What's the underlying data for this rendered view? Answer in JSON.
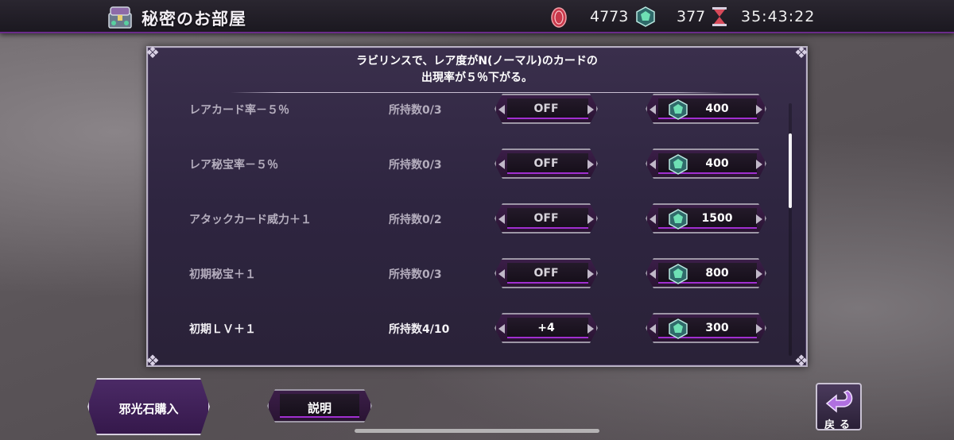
{
  "header": {
    "title": "秘密のお部屋",
    "coins": "4773",
    "gems": "377",
    "timer": "35:43:22"
  },
  "panel": {
    "description_line1": "ラビリンスで、レア度がN(ノーマル)のカードの",
    "description_line2": "出現率が５％下がる。",
    "rows": [
      {
        "name": "レアカード率－５％",
        "owned": "所持数0/3",
        "toggle": "OFF",
        "price": "400"
      },
      {
        "name": "レア秘宝率－５％",
        "owned": "所持数0/3",
        "toggle": "OFF",
        "price": "400"
      },
      {
        "name": "アタックカード威力＋１",
        "owned": "所持数0/2",
        "toggle": "OFF",
        "price": "1500"
      },
      {
        "name": "初期秘宝＋１",
        "owned": "所持数0/3",
        "toggle": "OFF",
        "price": "800"
      },
      {
        "name": "初期ＬＶ＋１",
        "owned": "所持数4/10",
        "toggle": "+4",
        "price": "300"
      }
    ]
  },
  "footer": {
    "buy_label": "邪光石購入",
    "explain_label": "説明",
    "back_label": "戻る"
  },
  "icons": {
    "room": "treasure-chest-icon",
    "coin": "coin-icon",
    "gem": "gem-icon",
    "hourglass": "hourglass-icon",
    "back": "back-arrow-icon"
  },
  "colors": {
    "accent": "#a02fd0",
    "panel_bg": "#2e2540"
  }
}
